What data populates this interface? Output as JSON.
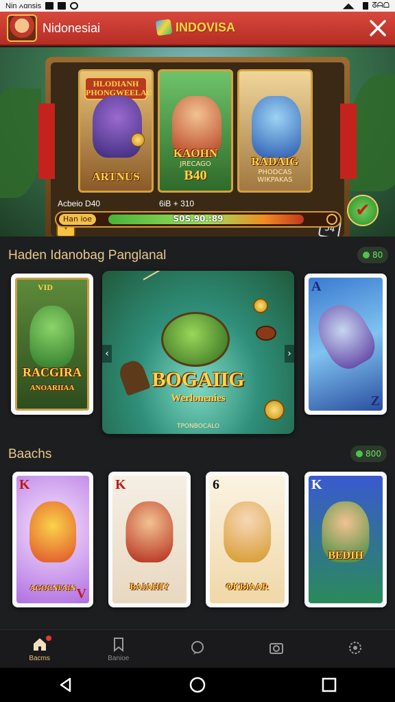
{
  "status_bar": {
    "carrier": "Nin ꭅɑnsis",
    "time": "ᘔᗩᗝ"
  },
  "header": {
    "region": "Nidonesiai",
    "brand": "INDOVISA"
  },
  "hero": {
    "cards": [
      {
        "top_title": "HLODIANH PHONGWEELAOS",
        "caption": "ARTNUS"
      },
      {
        "caption": "KAOHN",
        "sub": "JRECAGO",
        "number": "B40"
      },
      {
        "caption": "RADAIG",
        "sub": "PHODCAS",
        "extra": "WIKPAKAS"
      }
    ],
    "badge_right": "54",
    "stat_left": "Acbeio D40",
    "stat_right": "6iB + 310",
    "progress_label": "Han ioe",
    "progress_value": "S0S.90.:89",
    "progress_fraction": 0.72
  },
  "section1": {
    "title": "Haden Idanobag Panglanal",
    "pill": "80",
    "left_card": {
      "caption": "RACGIRA",
      "sub": "ANOARIIAA",
      "top": "VID"
    },
    "featured": {
      "title": "BOGAIIG",
      "subtitle": "Werlonenies",
      "foot": "TPONBOCALO"
    },
    "right_card": {
      "corner_top": "A",
      "corner_bottom": "Z"
    }
  },
  "section2": {
    "title": "Baachs",
    "pill": "800",
    "cards": [
      {
        "corner_top": "K",
        "corner_bottom": "V",
        "caption": "AGOCNFAIN"
      },
      {
        "corner_top": "K",
        "corner_bottom": "",
        "caption": "BAIAHIY"
      },
      {
        "corner_top": "6",
        "corner_bottom": "",
        "caption": "OKBIAAR"
      },
      {
        "corner_top": "K",
        "corner_bottom": "",
        "caption": "BEDIH"
      }
    ]
  },
  "tabs": [
    {
      "label": "Bacms",
      "icon": "home-icon"
    },
    {
      "label": "Banioe",
      "icon": "bookmark-icon"
    },
    {
      "label": "",
      "icon": "chat-icon"
    },
    {
      "label": "",
      "icon": "camera-icon"
    },
    {
      "label": "",
      "icon": "settings-icon"
    }
  ],
  "colors": {
    "header_red": "#c23a30",
    "accent_gold": "#e8c27a",
    "pill_green": "#6fe06a"
  }
}
